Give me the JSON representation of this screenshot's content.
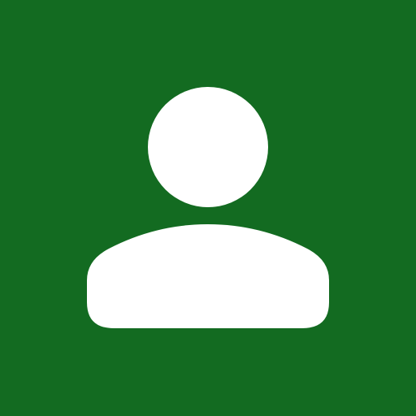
{
  "avatar": {
    "icon": "user-icon",
    "background_color": "#136b21",
    "foreground_color": "#ffffff"
  }
}
